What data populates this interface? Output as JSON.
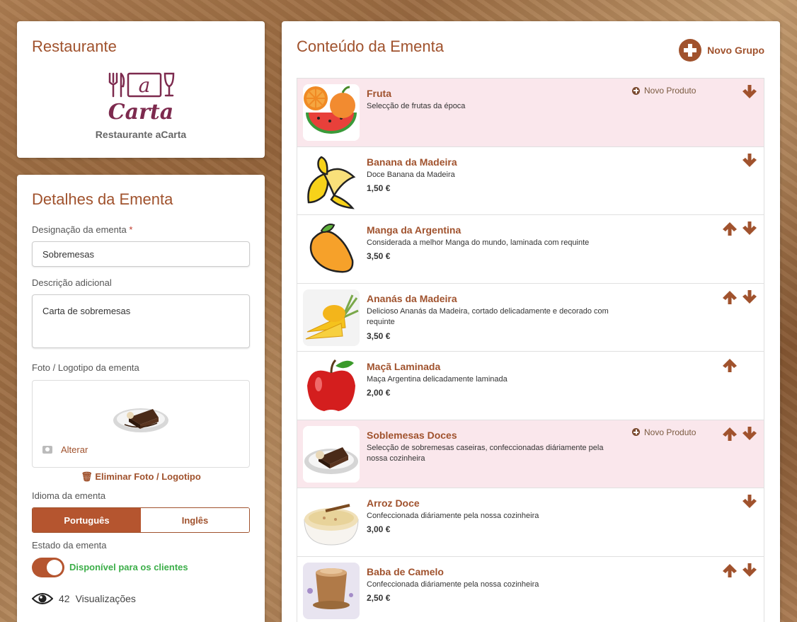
{
  "restaurant": {
    "heading": "Restaurante",
    "logo_top": "a",
    "logo_bottom": "Carta",
    "name": "Restaurante aCarta"
  },
  "details": {
    "heading": "Detalhes da Ementa",
    "designation_label": "Designação da ementa",
    "required_mark": "*",
    "designation_value": "Sobremesas",
    "description_label": "Descrição adicional",
    "description_value": "Carta de sobremesas",
    "photo_label": "Foto / Logotipo da ementa",
    "change_label": "Alterar",
    "delete_label": "Eliminar Foto / Logotipo",
    "language_label": "Idioma da ementa",
    "languages": [
      "Português",
      "Inglês"
    ],
    "selected_language": "Português",
    "state_label": "Estado da ementa",
    "state_value": "Disponível para os clientes",
    "views_count": "42",
    "views_label": "Visualizações"
  },
  "menu": {
    "heading": "Conteúdo da Ementa",
    "new_group_label": "Novo Grupo",
    "new_product_label": "Novo Produto",
    "rows": [
      {
        "type": "group",
        "title": "Fruta",
        "desc": "Selecção de frutas da época",
        "price": "",
        "icon": "fruit-icon",
        "up": false,
        "down": true
      },
      {
        "type": "product",
        "title": "Banana da Madeira",
        "desc": "Doce Banana da Madeira",
        "price": "1,50 €",
        "icon": "banana-icon",
        "up": false,
        "down": true
      },
      {
        "type": "product",
        "title": "Manga da Argentina",
        "desc": "Considerada a melhor Manga do mundo, laminada com requinte",
        "price": "3,50 €",
        "icon": "mango-icon",
        "up": true,
        "down": true
      },
      {
        "type": "product",
        "title": "Ananás da Madeira",
        "desc": "Delicioso Ananás da Madeira, cortado delicadamente e decorado com requinte",
        "price": "3,50 €",
        "icon": "pineapple-icon",
        "up": true,
        "down": true
      },
      {
        "type": "product",
        "title": "Maçã Laminada",
        "desc": "Maça Argentina delicadamente laminada",
        "price": "2,00 €",
        "icon": "apple-icon",
        "up": true,
        "down": false
      },
      {
        "type": "group",
        "title": "Soblemesas Doces",
        "desc": "Selecção de sobremesas caseiras, confeccionadas diáriamente pela nossa cozinheira",
        "price": "",
        "icon": "cake-icon",
        "up": true,
        "down": true
      },
      {
        "type": "product",
        "title": "Arroz Doce",
        "desc": "Confeccionada diáriamente pela nossa cozinheira",
        "price": "3,00 €",
        "icon": "rice-pudding-icon",
        "up": false,
        "down": true
      },
      {
        "type": "product",
        "title": "Baba de Camelo",
        "desc": "Confeccionada diáriamente pela nossa cozinheira",
        "price": "2,50 €",
        "icon": "mousse-icon",
        "up": true,
        "down": true
      }
    ]
  },
  "colors": {
    "accent": "#a0522d",
    "group_bg": "#fae7ec",
    "success": "#3cae49"
  }
}
